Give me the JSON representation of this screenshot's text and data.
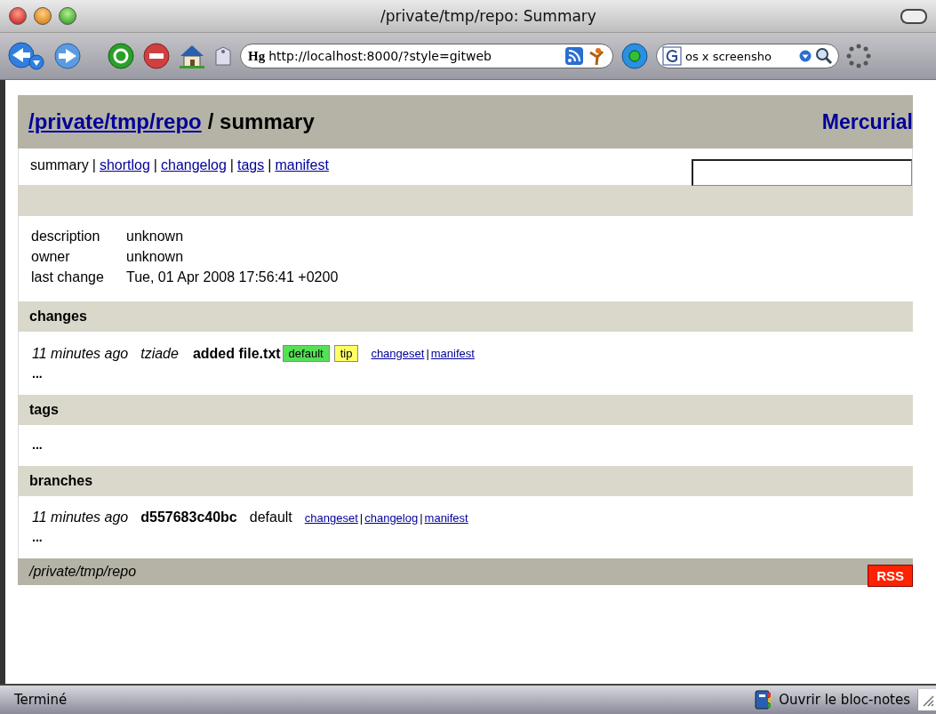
{
  "window": {
    "title": "/private/tmp/repo: Summary"
  },
  "toolbar": {
    "url_badge": "Hg",
    "url": "http://localhost:8000/?style=gitweb",
    "search_value": "os x screensho"
  },
  "page": {
    "header": {
      "repo_link": "/private/tmp/repo",
      "title_rest": "/ summary",
      "brand": "Mercurial"
    },
    "nav": {
      "items": [
        {
          "label": "summary",
          "selected": true
        },
        {
          "label": "shortlog",
          "selected": false
        },
        {
          "label": "changelog",
          "selected": false
        },
        {
          "label": "tags",
          "selected": false
        },
        {
          "label": "manifest",
          "selected": false
        }
      ],
      "separator": "|"
    },
    "metadata": [
      {
        "label": "description",
        "value": "unknown"
      },
      {
        "label": "owner",
        "value": "unknown"
      },
      {
        "label": "last change",
        "value": "Tue, 01 Apr 2008 17:56:41 +0200"
      }
    ],
    "sections": [
      {
        "title": "changes",
        "entries": [
          {
            "kind": "changeset",
            "age": "11 minutes ago",
            "author": "tziade",
            "description": "added file.txt",
            "tags": [
              {
                "label": "default",
                "color": "#55e055"
              },
              {
                "label": "tip",
                "color": "#ffff66"
              }
            ],
            "links": [
              "changeset",
              "manifest"
            ],
            "link_separator": "|"
          }
        ],
        "more": "..."
      },
      {
        "title": "tags",
        "more": "..."
      },
      {
        "title": "branches",
        "entries": [
          {
            "kind": "branch",
            "age": "11 minutes ago",
            "node": "d557683c40bc",
            "branch": "default",
            "links": [
              "changeset",
              "changelog",
              "manifest"
            ],
            "link_separator": "|"
          }
        ],
        "more": "..."
      }
    ],
    "footer": {
      "path": "/private/tmp/repo",
      "rss": "RSS"
    }
  },
  "status_bar": {
    "left": "Terminé",
    "right": "Ouvrir le bloc-notes"
  }
}
